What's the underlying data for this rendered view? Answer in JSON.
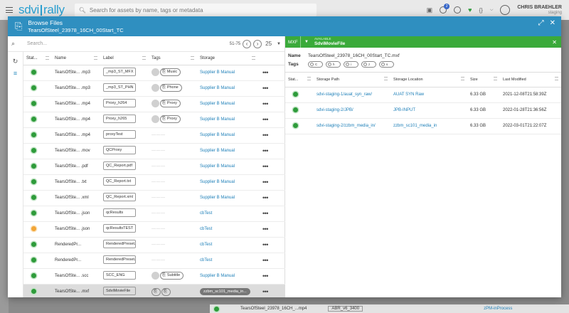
{
  "app": {
    "logo_left": "sdvi",
    "logo_right": "rally",
    "search_placeholder": "Search for assets by name, tags or metadata",
    "notification_count": "2",
    "user_name": "CHRIS BRAEHLER",
    "environment": "staging"
  },
  "background_row": {
    "name": "TearsOfSteel_23978_16CH_...mp4",
    "label": "ABR_v6_3400",
    "storage": "zPM-inProcess"
  },
  "modal": {
    "title": "Browse Files",
    "subtitle": "TearsOfSteel_23978_16CH_00Start_TC",
    "search_placeholder": "Search...",
    "page_range": "51-75",
    "per_page": "25",
    "columns": [
      "Stat...",
      "Name",
      "Label",
      "Tags",
      "Storage"
    ],
    "rows": [
      {
        "status": "green",
        "name": "TearsOfSte... .mp3",
        "label": "_mp3_ST_MFX",
        "tag": "Music",
        "storage": "Supplier B Manual"
      },
      {
        "status": "green",
        "name": "TearsOfSte... .mp3",
        "label": "_mp3_ST_PHN",
        "tag": "Phone",
        "storage": "Supplier B Manual"
      },
      {
        "status": "green",
        "name": "TearsOfSte... .mp4",
        "label": "Proxy_h264",
        "tag": "Proxy",
        "storage": "Supplier B Manual"
      },
      {
        "status": "green",
        "name": "TearsOfSte... .mp4",
        "label": "Proxy_h265",
        "tag": "Proxy",
        "storage": "Supplier B Manual"
      },
      {
        "status": "green",
        "name": "TearsOfSte... .mp4",
        "label": "proxyTest",
        "tag": "",
        "storage": "Supplier B Manual"
      },
      {
        "status": "green",
        "name": "TearsOfSte... .mov",
        "label": "QCProxy",
        "tag": "",
        "storage": "Supplier B Manual"
      },
      {
        "status": "green",
        "name": "TearsOfSte... .pdf",
        "label": "QC_Report.pdf",
        "tag": "",
        "storage": "Supplier B Manual"
      },
      {
        "status": "green",
        "name": "TearsOfSte... .txt",
        "label": "QC_Report.txt",
        "tag": "",
        "storage": "Supplier B Manual"
      },
      {
        "status": "green",
        "name": "TearsOfSte... .xml",
        "label": "QC_Report.xml",
        "tag": "",
        "storage": "Supplier B Manual"
      },
      {
        "status": "green",
        "name": "TearsOfSte... .json",
        "label": "qcResults",
        "tag": "",
        "storage": "cbTest"
      },
      {
        "status": "orange",
        "name": "TearsOfSte... .json",
        "label": "qcResultsTEST",
        "tag": "",
        "storage": "cbTest"
      },
      {
        "status": "green",
        "name": "RenderedPr...",
        "label": "RenderedPreset...",
        "tag": "",
        "storage": "cbTest"
      },
      {
        "status": "green",
        "name": "RenderedPr...",
        "label": "RenderedPreset...",
        "tag": "",
        "storage": "cbTest"
      },
      {
        "status": "green",
        "name": "TearsOfSte... .scc",
        "label": "SCC_ENG",
        "tag": "Subtitle",
        "storage": "Supplier B Manual"
      },
      {
        "status": "green",
        "name": "TearsOfSte... .mxf",
        "label": "SdviMovieFile",
        "tag": "",
        "storage": "zzbm_sc101_media_in..."
      }
    ]
  },
  "detail": {
    "type": "MXF",
    "status": "AVAILABLE",
    "label": "SdviMovieFile",
    "name_label": "Name",
    "name_value": "TearsOfSteel_23978_16CH_00Start_TC.mxf",
    "tags_label": "Tags",
    "mini_tags": [
      "C",
      "h",
      "i",
      "z",
      "s"
    ],
    "columns": [
      "Stat...",
      "Storage Path",
      "Storage Location",
      "Size",
      "Last Modified"
    ],
    "rows": [
      {
        "path": "sdvi-staging-1/auat_syn_raw/",
        "location": "AUAT SYN Raw",
        "size": "6.33 GB",
        "modified": "2021-12-08T21:58:39Z"
      },
      {
        "path": "sdvi-staging-2/JPB/",
        "location": "JPB-INPUT",
        "size": "6.33 GB",
        "modified": "2022-01-28T21:36:56Z"
      },
      {
        "path": "sdvi-staging-2/zzbm_media_in/",
        "location": "zzbm_sc101_media_in",
        "size": "6.33 GB",
        "modified": "2022-03-01T21:22:07Z"
      }
    ]
  }
}
